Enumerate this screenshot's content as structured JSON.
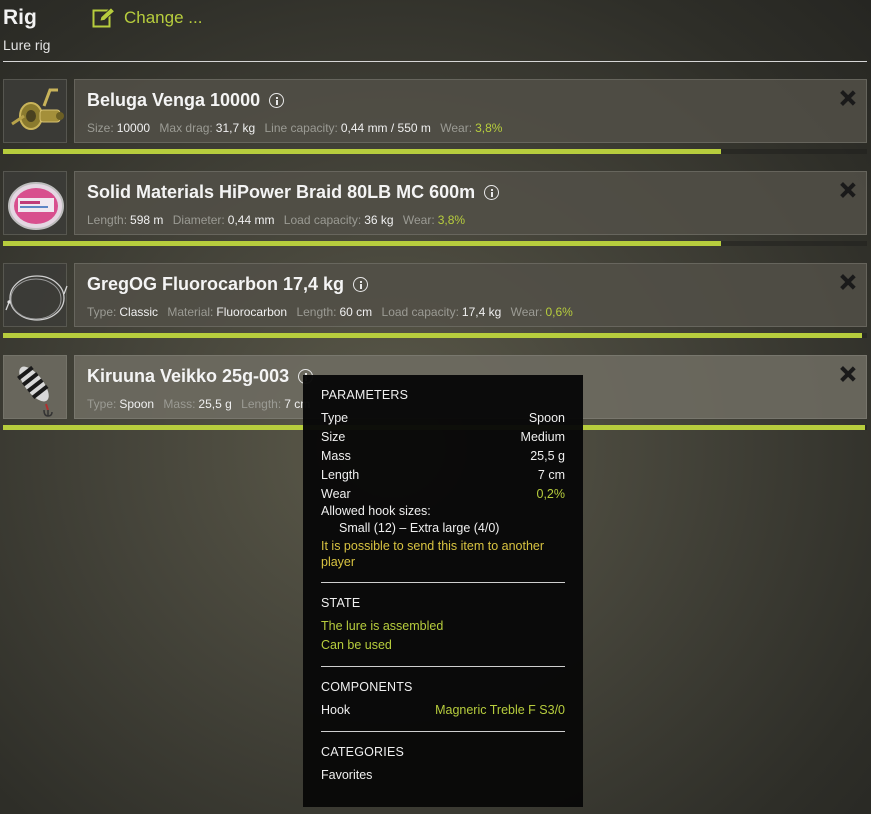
{
  "header": {
    "title": "Rig",
    "subtitle": "Lure rig",
    "change_label": "Change ..."
  },
  "colors": {
    "accent": "#b7cd3d",
    "tradeable": "#d8c341"
  },
  "items": [
    {
      "name": "Beluga Venga 10000",
      "icon": "reel-icon",
      "stats": [
        {
          "k": "Size:",
          "v": "10000"
        },
        {
          "k": "Max drag:",
          "v": "31,7 kg"
        },
        {
          "k": "Line capacity:",
          "v": "0,44 mm / 550 m"
        },
        {
          "k": "Wear:",
          "v": "3,8%",
          "wear": true
        }
      ],
      "condition": 0.962
    },
    {
      "name": "Solid Materials HiPower Braid 80LB MC 600m",
      "icon": "line-spool-icon",
      "stats": [
        {
          "k": "Length:",
          "v": "598 m"
        },
        {
          "k": "Diameter:",
          "v": "0,44 mm"
        },
        {
          "k": "Load capacity:",
          "v": "36 kg"
        },
        {
          "k": "Wear:",
          "v": "3,8%",
          "wear": true
        }
      ],
      "condition": 0.962
    },
    {
      "name": "GregOG Fluorocarbon 17,4 kg",
      "icon": "leader-icon",
      "stats": [
        {
          "k": "Type:",
          "v": "Classic"
        },
        {
          "k": "Material:",
          "v": "Fluorocarbon"
        },
        {
          "k": "Length:",
          "v": "60 cm"
        },
        {
          "k": "Load capacity:",
          "v": "17,4 kg"
        },
        {
          "k": "Wear:",
          "v": "0,6%",
          "wear": true
        }
      ],
      "condition": 0.994
    },
    {
      "name": "Kiruuna Veikko 25g-003",
      "icon": "spoon-lure-icon",
      "stats": [
        {
          "k": "Type:",
          "v": "Spoon"
        },
        {
          "k": "Mass:",
          "v": "25,5 g"
        },
        {
          "k": "Length:",
          "v": "7 cm"
        }
      ],
      "condition": 0.998
    }
  ],
  "tooltip": {
    "parameters_heading": "PARAMETERS",
    "parameters": [
      {
        "k": "Type",
        "v": "Spoon"
      },
      {
        "k": "Size",
        "v": "Medium"
      },
      {
        "k": "Mass",
        "v": "25,5 g"
      },
      {
        "k": "Length",
        "v": "7 cm"
      },
      {
        "k": "Wear",
        "v": "0,2%"
      }
    ],
    "hook_sizes_label": "Allowed hook sizes:",
    "hook_sizes_value": "Small (12) – Extra large (4/0)",
    "tradeable_note": "It is possible to send this item to another player",
    "state_heading": "STATE",
    "state_lines": [
      "The lure is assembled",
      "Can be used"
    ],
    "components_heading": "COMPONENTS",
    "components": [
      {
        "k": "Hook",
        "v": "Magneric Treble F S3/0"
      }
    ],
    "categories_heading": "CATEGORIES",
    "categories": [
      "Favorites"
    ]
  }
}
